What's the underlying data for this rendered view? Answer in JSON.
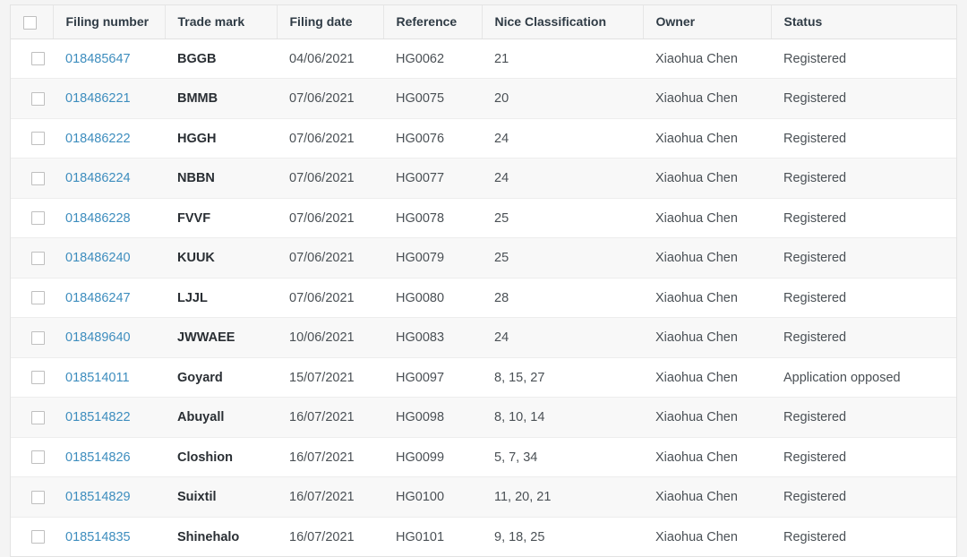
{
  "table": {
    "select_all_checkbox": "unchecked",
    "columns": [
      {
        "key": "check",
        "label": ""
      },
      {
        "key": "filing",
        "label": "Filing number"
      },
      {
        "key": "trademark",
        "label": "Trade mark"
      },
      {
        "key": "date",
        "label": "Filing date"
      },
      {
        "key": "reference",
        "label": "Reference"
      },
      {
        "key": "nice",
        "label": "Nice Classification"
      },
      {
        "key": "owner",
        "label": "Owner"
      },
      {
        "key": "status",
        "label": "Status"
      }
    ],
    "rows": [
      {
        "filing": "018485647",
        "trademark": "BGGB",
        "date": "04/06/2021",
        "reference": "HG0062",
        "nice": "21",
        "owner": "Xiaohua Chen",
        "status": "Registered"
      },
      {
        "filing": "018486221",
        "trademark": "BMMB",
        "date": "07/06/2021",
        "reference": "HG0075",
        "nice": "20",
        "owner": "Xiaohua Chen",
        "status": "Registered"
      },
      {
        "filing": "018486222",
        "trademark": "HGGH",
        "date": "07/06/2021",
        "reference": "HG0076",
        "nice": "24",
        "owner": "Xiaohua Chen",
        "status": "Registered"
      },
      {
        "filing": "018486224",
        "trademark": "NBBN",
        "date": "07/06/2021",
        "reference": "HG0077",
        "nice": "24",
        "owner": "Xiaohua Chen",
        "status": "Registered"
      },
      {
        "filing": "018486228",
        "trademark": "FVVF",
        "date": "07/06/2021",
        "reference": "HG0078",
        "nice": "25",
        "owner": "Xiaohua Chen",
        "status": "Registered"
      },
      {
        "filing": "018486240",
        "trademark": "KUUK",
        "date": "07/06/2021",
        "reference": "HG0079",
        "nice": "25",
        "owner": "Xiaohua Chen",
        "status": "Registered"
      },
      {
        "filing": "018486247",
        "trademark": "LJJL",
        "date": "07/06/2021",
        "reference": "HG0080",
        "nice": "28",
        "owner": "Xiaohua Chen",
        "status": "Registered"
      },
      {
        "filing": "018489640",
        "trademark": "JWWAEE",
        "date": "10/06/2021",
        "reference": "HG0083",
        "nice": "24",
        "owner": "Xiaohua Chen",
        "status": "Registered"
      },
      {
        "filing": "018514011",
        "trademark": "Goyard",
        "date": "15/07/2021",
        "reference": "HG0097",
        "nice": "8, 15, 27",
        "owner": "Xiaohua Chen",
        "status": "Application opposed"
      },
      {
        "filing": "018514822",
        "trademark": "Abuyall",
        "date": "16/07/2021",
        "reference": "HG0098",
        "nice": "8, 10, 14",
        "owner": "Xiaohua Chen",
        "status": "Registered"
      },
      {
        "filing": "018514826",
        "trademark": "Closhion",
        "date": "16/07/2021",
        "reference": "HG0099",
        "nice": "5, 7, 34",
        "owner": "Xiaohua Chen",
        "status": "Registered"
      },
      {
        "filing": "018514829",
        "trademark": "Suixtil",
        "date": "16/07/2021",
        "reference": "HG0100",
        "nice": "11, 20, 21",
        "owner": "Xiaohua Chen",
        "status": "Registered"
      },
      {
        "filing": "018514835",
        "trademark": "Shinehalo",
        "date": "16/07/2021",
        "reference": "HG0101",
        "nice": "9, 18, 25",
        "owner": "Xiaohua Chen",
        "status": "Registered"
      }
    ]
  },
  "colors": {
    "link": "#3d8dbe",
    "header_bg": "#f7f7f7",
    "row_alt_bg": "#f8f8f8",
    "page_bg": "#f4f4f4",
    "border": "#e3e3e3",
    "text": "#4a5055"
  }
}
